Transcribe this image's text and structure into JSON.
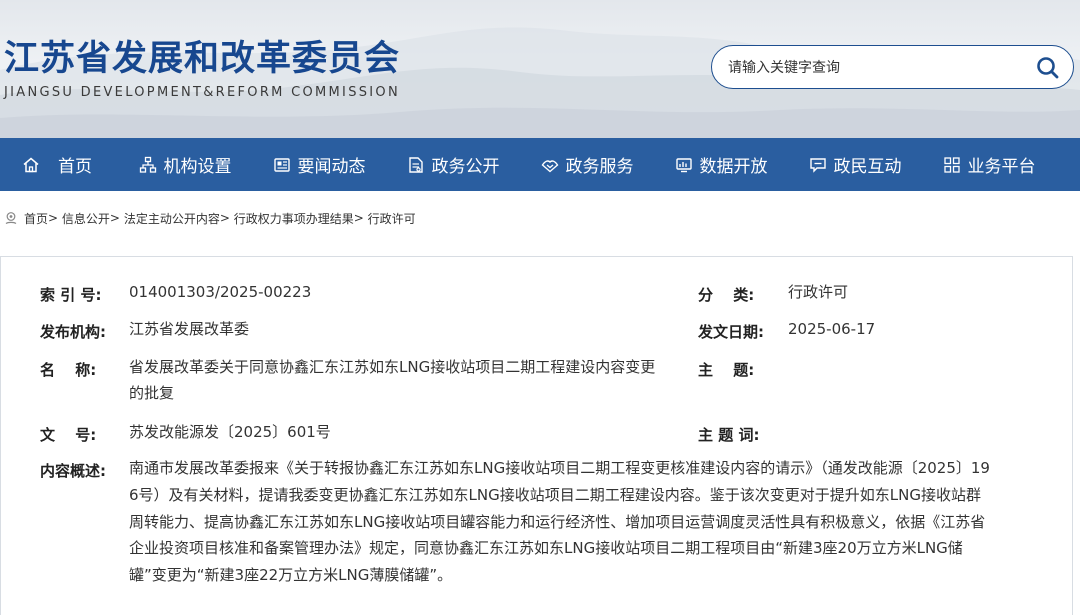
{
  "site": {
    "title": "江苏省发展和改革委员会",
    "subtitle": "JIANGSU DEVELOPMENT&REFORM COMMISSION"
  },
  "search": {
    "placeholder": "请输入关键字查询",
    "icon": "search-icon"
  },
  "nav": {
    "items": [
      {
        "label": "首页",
        "icon": "home-icon"
      },
      {
        "label": "机构设置",
        "icon": "org-chart-icon"
      },
      {
        "label": "要闻动态",
        "icon": "news-icon"
      },
      {
        "label": "政务公开",
        "icon": "document-icon"
      },
      {
        "label": "政务服务",
        "icon": "service-icon"
      },
      {
        "label": "数据开放",
        "icon": "data-icon"
      },
      {
        "label": "政民互动",
        "icon": "chat-icon"
      },
      {
        "label": "业务平台",
        "icon": "grid-icon"
      }
    ]
  },
  "breadcrumb": {
    "icon": "location-icon",
    "items": [
      "首页",
      "信息公开",
      "法定主动公开内容",
      "行政权力事项办理结果",
      "行政许可"
    ],
    "separator": ">"
  },
  "meta": {
    "index_label": "索 引 号:",
    "index_value": "014001303/2025-00223",
    "category_label": "分　 类:",
    "category_value": "行政许可",
    "publisher_label": "发布机构:",
    "publisher_value": "江苏省发展改革委",
    "date_label": "发文日期:",
    "date_value": "2025-06-17",
    "name_label": "名　 称:",
    "name_value": "省发展改革委关于同意协鑫汇东江苏如东LNG接收站项目二期工程建设内容变更的批复",
    "subject_label": "主　 题:",
    "subject_value": "",
    "docno_label": "文　 号:",
    "docno_value": "苏发改能源发〔2025〕601号",
    "keywords_label": "主 题 词:",
    "keywords_value": "",
    "summary_label": "内容概述:",
    "summary_value": "南通市发展改革委报来《关于转报协鑫汇东江苏如东LNG接收站项目二期工程变更核准建设内容的请示》（通发改能源〔2025〕196号）及有关材料，提请我委变更协鑫汇东江苏如东LNG接收站项目二期工程建设内容。鉴于该次变更对于提升如东LNG接收站群周转能力、提高协鑫汇东江苏如东LNG接收站项目罐容能力和运行经济性、增加项目运营调度灵活性具有积极意义，依据《江苏省企业投资项目核准和备案管理办法》规定，同意协鑫汇东江苏如东LNG接收站项目二期工程项目由“新建3座20万立方米LNG储罐”变更为“新建3座22万立方米LNG薄膜储罐”。"
  },
  "colors": {
    "brand_blue": "#17478f",
    "nav_bg": "#2a5ea0"
  }
}
